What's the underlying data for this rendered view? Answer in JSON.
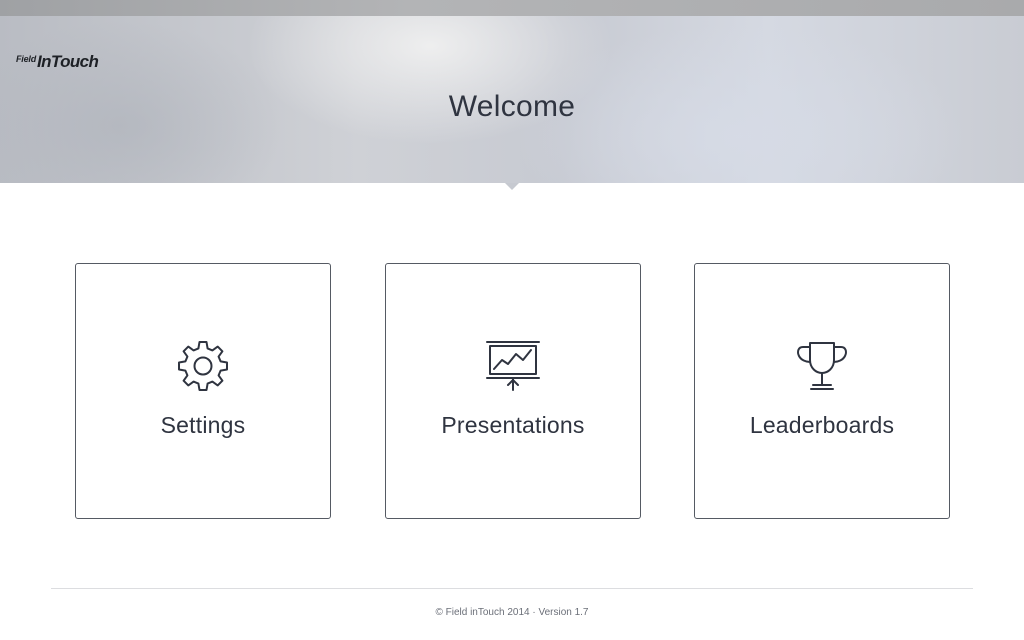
{
  "header": {
    "logo_prefix": "Field",
    "logo_main": "InTouch",
    "title": "Welcome"
  },
  "tiles": [
    {
      "label": "Settings",
      "icon": "gear-icon"
    },
    {
      "label": "Presentations",
      "icon": "presentation-chart-icon"
    },
    {
      "label": "Leaderboards",
      "icon": "trophy-icon"
    }
  ],
  "footer": {
    "text": "© Field inTouch 2014 · Version 1.7"
  },
  "colors": {
    "text": "#2f3440",
    "tile_border": "#555a63",
    "icon_stroke": "#2f3440"
  }
}
